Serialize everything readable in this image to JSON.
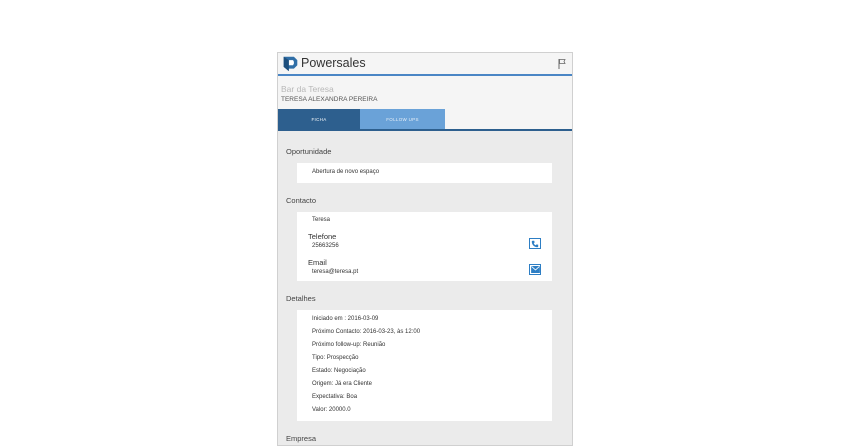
{
  "app": {
    "title": "Powersales"
  },
  "header": {
    "name": "Bar da Teresa",
    "person": "TERESA ALEXANDRA PEREIRA"
  },
  "tabs": [
    {
      "label": "FICHA",
      "active": true
    },
    {
      "label": "FOLLOW UPS",
      "active": false
    }
  ],
  "oportunidade": {
    "title": "Oportunidade",
    "value": "Abertura de novo espaço"
  },
  "contacto": {
    "title": "Contacto",
    "name": "Teresa",
    "telefone_label": "Telefone",
    "telefone": "25663256",
    "email_label": "Email",
    "email": "teresa@teresa.pt"
  },
  "detalhes": {
    "title": "Detalhes",
    "items": [
      "Iniciado em : 2016-03-09",
      "Próximo Contacto: 2016-03-23, às 12:00",
      "Próximo follow-up: Reunião",
      "Tipo: Prospecção",
      "Estado: Negociação",
      "Origem: Já era Cliente",
      "Expectativa: Boa",
      "Valor: 20000.0"
    ]
  },
  "empresa": {
    "title": "Empresa"
  },
  "icons": {
    "logo": "powersales-logo-icon",
    "flag": "flag-icon",
    "phone": "phone-icon",
    "email": "mail-icon"
  },
  "colors": {
    "accent": "#4a86c5",
    "tab_active": "#2d5f8e",
    "tab_inactive": "#6aa2d8",
    "background": "#ebebeb"
  }
}
